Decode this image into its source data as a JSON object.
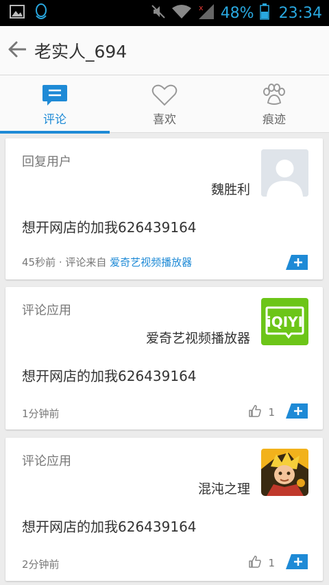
{
  "status_bar": {
    "battery_percent": "48%",
    "time": "23:34",
    "icons": [
      "image-icon",
      "qq-icon",
      "mute-icon",
      "wifi-icon",
      "signal-icon",
      "battery-icon"
    ],
    "accent_color": "#29a8e0"
  },
  "header": {
    "title": "老实人_694"
  },
  "tabs": [
    {
      "label": "评论",
      "icon": "comment-icon",
      "active": true
    },
    {
      "label": "喜欢",
      "icon": "heart-icon",
      "active": false
    },
    {
      "label": "痕迹",
      "icon": "paw-icon",
      "active": false
    }
  ],
  "cards": [
    {
      "type_label": "回复用户",
      "name": "魏胜利",
      "body": "想开网店的加我626439164",
      "time": "45秒前",
      "source_prefix": " · 评论来自 ",
      "source": "爱奇艺视频播放器",
      "avatar_icon": "default-user-avatar"
    },
    {
      "type_label": "评论应用",
      "name": "爱奇艺视频播放器",
      "body": "想开网店的加我626439164",
      "time": "1分钟前",
      "likes": "1",
      "avatar_icon": "iqiyi-app-icon",
      "avatar_text": "iQIYI"
    },
    {
      "type_label": "评论应用",
      "name": "混沌之理",
      "body": "想开网店的加我626439164",
      "time": "2分钟前",
      "likes": "1",
      "avatar_icon": "game-app-icon"
    }
  ],
  "colors": {
    "accent": "#1e8ad6",
    "iqiyi_green": "#6cc518",
    "background": "#ececec"
  }
}
